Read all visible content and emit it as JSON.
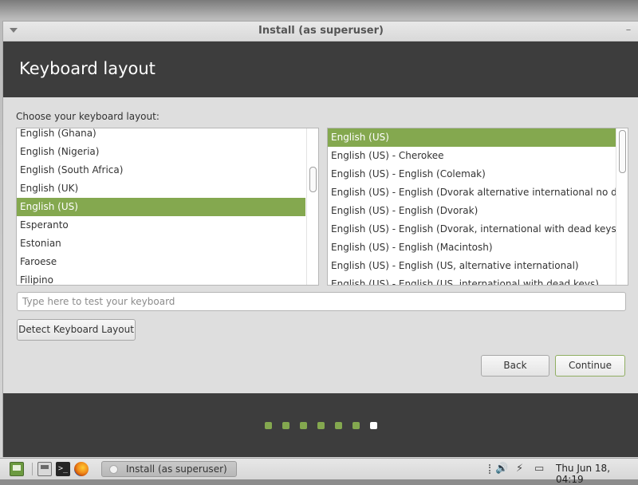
{
  "window": {
    "title": "Install (as superuser)",
    "minimize_glyph": "–"
  },
  "header": {
    "title": "Keyboard layout"
  },
  "prompt": "Choose your keyboard layout:",
  "layouts": [
    {
      "label": "English (Ghana)",
      "selected": false
    },
    {
      "label": "English (Nigeria)",
      "selected": false
    },
    {
      "label": "English (South Africa)",
      "selected": false
    },
    {
      "label": "English (UK)",
      "selected": false
    },
    {
      "label": "English (US)",
      "selected": true
    },
    {
      "label": "Esperanto",
      "selected": false
    },
    {
      "label": "Estonian",
      "selected": false
    },
    {
      "label": "Faroese",
      "selected": false
    },
    {
      "label": "Filipino",
      "selected": false
    }
  ],
  "variants": [
    {
      "label": "English (US)",
      "selected": true
    },
    {
      "label": "English (US) - Cherokee",
      "selected": false
    },
    {
      "label": "English (US) - English (Colemak)",
      "selected": false
    },
    {
      "label": "English (US) - English (Dvorak alternative international no dead k",
      "selected": false
    },
    {
      "label": "English (US) - English (Dvorak)",
      "selected": false
    },
    {
      "label": "English (US) - English (Dvorak, international with dead keys)",
      "selected": false
    },
    {
      "label": "English (US) - English (Macintosh)",
      "selected": false
    },
    {
      "label": "English (US) - English (US, alternative international)",
      "selected": false
    },
    {
      "label": "English (US) - English (US, international with dead keys)",
      "selected": false
    }
  ],
  "test_input": {
    "placeholder": "Type here to test your keyboard",
    "value": ""
  },
  "buttons": {
    "detect": "Detect Keyboard Layout",
    "back": "Back",
    "continue": "Continue"
  },
  "progress": {
    "total_steps": 7,
    "current_step": 7
  },
  "taskbar": {
    "icons": [
      "show-desktop-icon",
      "file-manager-icon",
      "terminal-icon",
      "firefox-icon"
    ],
    "terminal_glyph": ">_",
    "task_label": "Install (as superuser)",
    "volume_glyph": "🔊",
    "network_glyph": "⚡",
    "power_glyph": "▭",
    "clock": "Thu Jun 18, 04:19"
  },
  "colors": {
    "selection": "#84a84f",
    "header_bg": "#3d3d3d",
    "progress_done": "#84a84f",
    "progress_current": "#ffffff"
  }
}
